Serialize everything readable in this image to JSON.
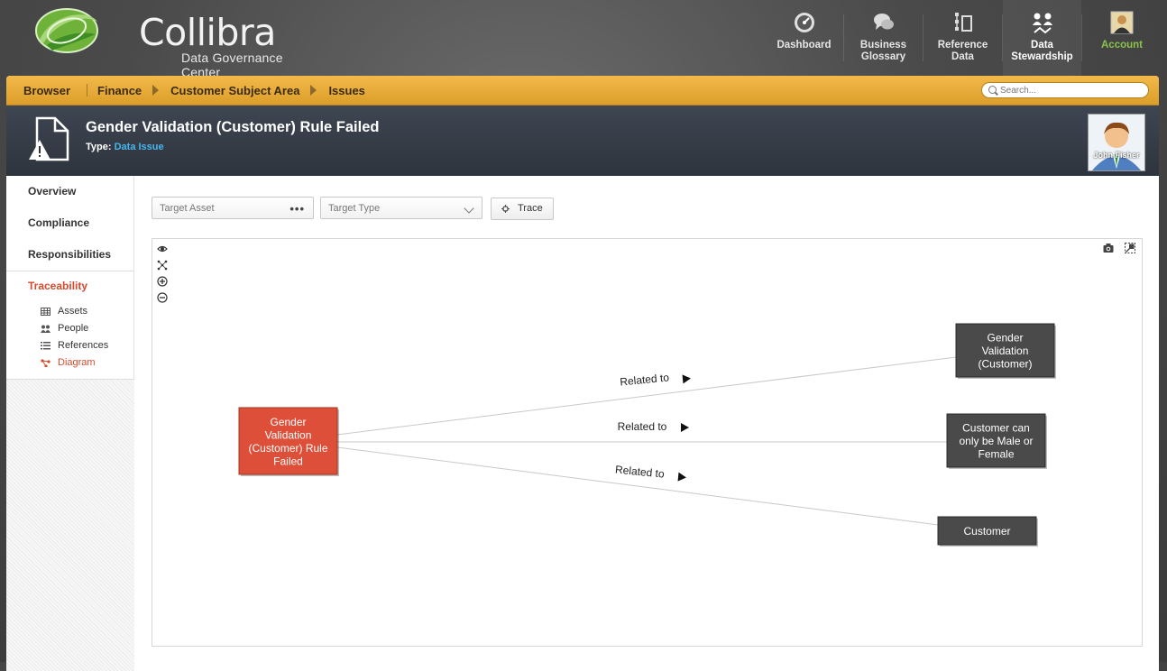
{
  "header": {
    "brand_title": "Collibra",
    "brand_subtitle": "Data Governance Center",
    "nav": [
      {
        "label_line1": "Dashboard",
        "label_line2": "",
        "icon": "dashboard-gauge-icon"
      },
      {
        "label_line1": "Business",
        "label_line2": "Glossary",
        "icon": "speech-bubbles-icon"
      },
      {
        "label_line1": "Reference",
        "label_line2": "Data",
        "icon": "hierarchy-document-icon"
      },
      {
        "label_line1": "Data",
        "label_line2": "Stewardship",
        "icon": "people-connect-icon",
        "active": true
      },
      {
        "label_line1": "Account",
        "label_line2": "",
        "icon": "user-portrait-icon"
      }
    ]
  },
  "breadcrumb": {
    "root": "Browser",
    "items": [
      "Finance",
      "Customer Subject Area",
      "Issues"
    ]
  },
  "search": {
    "placeholder": "Search..."
  },
  "asset": {
    "title": "Gender Validation (Customer) Rule Failed",
    "type_label": "Type:",
    "type_value": "Data Issue",
    "user_name": "John Fisher"
  },
  "sidebar": {
    "items": [
      "Overview",
      "Compliance",
      "Responsibilities"
    ],
    "active_item": "Traceability",
    "sub_items": [
      {
        "label": "Assets",
        "icon": "table-grid-icon"
      },
      {
        "label": "People",
        "icon": "people-icon"
      },
      {
        "label": "References",
        "icon": "list-lines-icon"
      },
      {
        "label": "Diagram",
        "icon": "diagram-network-icon",
        "active": true
      }
    ]
  },
  "toolbar": {
    "target_asset_placeholder": "Target Asset",
    "target_type_placeholder": "Target Type",
    "trace_label": "Trace"
  },
  "diagram": {
    "source_node": {
      "lines": [
        "Gender",
        "Validation",
        "(Customer) Rule",
        "Failed"
      ],
      "color": "#dd4f38"
    },
    "target_nodes": [
      {
        "lines": [
          "Gender",
          "Validation",
          "(Customer)"
        ],
        "color": "#4a4a4a"
      },
      {
        "lines": [
          "Customer can",
          "only be Male or",
          "Female"
        ],
        "color": "#4a4a4a"
      },
      {
        "lines": [
          "Customer"
        ],
        "color": "#4a4a4a"
      }
    ],
    "edges": [
      {
        "label": "Related to"
      },
      {
        "label": "Related to"
      },
      {
        "label": "Related to"
      }
    ],
    "tools": [
      "eye-icon",
      "layout-scatter-icon",
      "zoom-in-icon",
      "zoom-out-icon"
    ],
    "corner_tools": [
      "camera-icon",
      "fullscreen-icon"
    ]
  },
  "colors": {
    "accent_orange": "#e6aa3c",
    "active_red": "#d44a2c",
    "link_blue": "#47b6ee",
    "account_green": "#8bc34a"
  }
}
